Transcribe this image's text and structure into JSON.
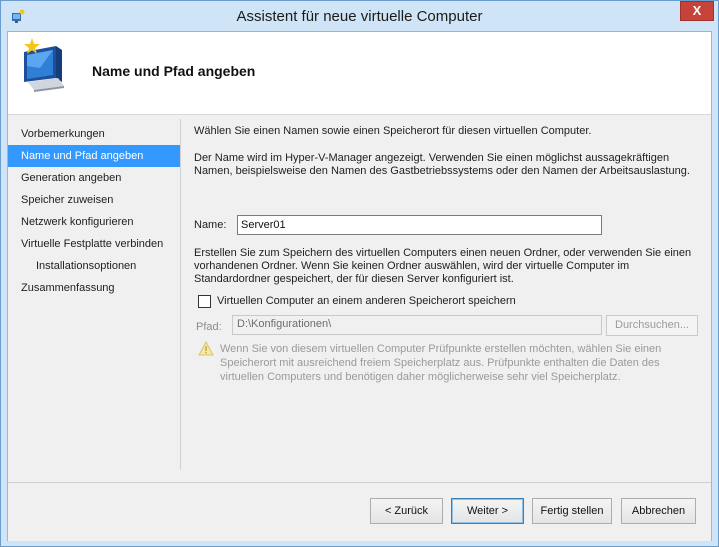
{
  "window": {
    "title": "Assistent für neue virtuelle Computer",
    "close_label": "X"
  },
  "header": {
    "title": "Name und Pfad angeben"
  },
  "nav": {
    "items": [
      {
        "label": "Vorbemerkungen",
        "selected": false,
        "sub": false
      },
      {
        "label": "Name und Pfad angeben",
        "selected": true,
        "sub": false
      },
      {
        "label": "Generation angeben",
        "selected": false,
        "sub": false
      },
      {
        "label": "Speicher zuweisen",
        "selected": false,
        "sub": false
      },
      {
        "label": "Netzwerk konfigurieren",
        "selected": false,
        "sub": false
      },
      {
        "label": "Virtuelle Festplatte verbinden",
        "selected": false,
        "sub": false
      },
      {
        "label": "Installationsoptionen",
        "selected": false,
        "sub": true
      },
      {
        "label": "Zusammenfassung",
        "selected": false,
        "sub": false
      }
    ]
  },
  "content": {
    "intro": "Wählen Sie einen Namen sowie einen Speicherort für diesen virtuellen Computer.",
    "description_line1": "Der Name wird im Hyper-V-Manager angezeigt. Verwenden Sie einen möglichst aussagekräftigen",
    "description_line2": "Namen, beispielsweise den Namen des Gastbetriebssystems oder den Namen der Arbeitsauslastung.",
    "name_label": "Name:",
    "name_value": "Server01",
    "folder_line1": "Erstellen Sie zum Speichern des virtuellen Computers einen neuen Ordner, oder verwenden Sie einen",
    "folder_line2": "vorhandenen Ordner. Wenn Sie keinen Ordner auswählen, wird der virtuelle Computer im",
    "folder_line3": "Standardordner gespeichert, der für diesen Server konfiguriert ist.",
    "checkbox_label": "Virtuellen Computer an einem anderen Speicherort speichern",
    "checkbox_checked": false,
    "path_label": "Pfad:",
    "path_value": "D:\\Konfigurationen\\",
    "browse_label": "Durchsuchen...",
    "warning_line1": "Wenn Sie von diesem virtuellen Computer Prüfpunkte erstellen möchten, wählen Sie einen",
    "warning_line2": "Speicherort mit ausreichend freiem Speicherplatz aus. Prüfpunkte enthalten die Daten des",
    "warning_line3": "virtuellen Computers und benötigen daher möglicherweise sehr viel Speicherplatz."
  },
  "footer": {
    "back_label": "< Zurück",
    "next_label": "Weiter >",
    "finish_label": "Fertig stellen",
    "cancel_label": "Abbrechen"
  },
  "colors": {
    "title_bar": "#cfe4f6",
    "selection": "#3399ff",
    "close_button": "#c7433a"
  },
  "icons": {
    "app": "hyper-v-icon",
    "header": "new-virtual-machine-icon",
    "warning": "warning-icon"
  }
}
